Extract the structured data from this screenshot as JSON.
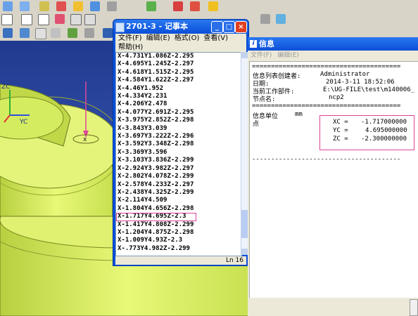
{
  "notepad": {
    "title": "2701-3 - 记事本",
    "menu": [
      "文件(F)",
      "编辑(E)",
      "格式(O)",
      "查看(V)",
      "帮助(H)"
    ],
    "lines": [
      "X-4.731Y1.086Z-2.295",
      "X-4.695Y1.245Z-2.297",
      "X-4.618Y1.515Z-2.295",
      "X-4.584Y1.622Z-2.297",
      "X-4.46Y1.952",
      "X-4.334Y2.231",
      "X-4.206Y2.478",
      "X-4.077Y2.691Z-2.295",
      "X-3.975Y2.852Z-2.298",
      "X-3.843Y3.039",
      "X-3.697Y3.222Z-2.296",
      "X-3.592Y3.348Z-2.298",
      "X-3.369Y3.596",
      "X-3.103Y3.836Z-2.299",
      "X-2.924Y3.982Z-2.297",
      "X-2.802Y4.078Z-2.299",
      "X-2.578Y4.233Z-2.297",
      "X-2.438Y4.325Z-2.299",
      "X-2.114Y4.509",
      "X-1.804Y4.656Z-2.298",
      "X-1.717Y4.695Z-2.3",
      "X-1.417Y4.808Z-2.299",
      "X-1.204Y4.875Z-2.298",
      "X-1.009Y4.93Z-2.3",
      "X-.773Y4.982Z-2.299"
    ],
    "selected_line": "X-1.717Y4.695Z-2.3",
    "status": "Ln 16"
  },
  "info": {
    "title": "信息",
    "menu": [
      "文件(F)",
      "编辑(E)"
    ],
    "creator_label": "信息列表创建者:",
    "creator": "Administrator",
    "date_label": "日期:",
    "date": "2014-3-11 18:52:06",
    "part_label": "当前工作部件:",
    "part": "E:\\UG-FILE\\test\\m140006_",
    "node_label": "节点名:",
    "node": "ncp2",
    "unit_label": "信息单位",
    "unit": "mm",
    "point_label": "点",
    "coords": [
      {
        "label": "XC =",
        "value": "-1.717000000"
      },
      {
        "label": "YC =",
        "value": "4.695000000"
      },
      {
        "label": "ZC =",
        "value": "-2.300000000"
      }
    ]
  },
  "cad": {
    "axis_label": "YC",
    "axis_label2": "ZC"
  },
  "colors": {
    "highlight": "#e0449a",
    "part": "#d8f060"
  }
}
